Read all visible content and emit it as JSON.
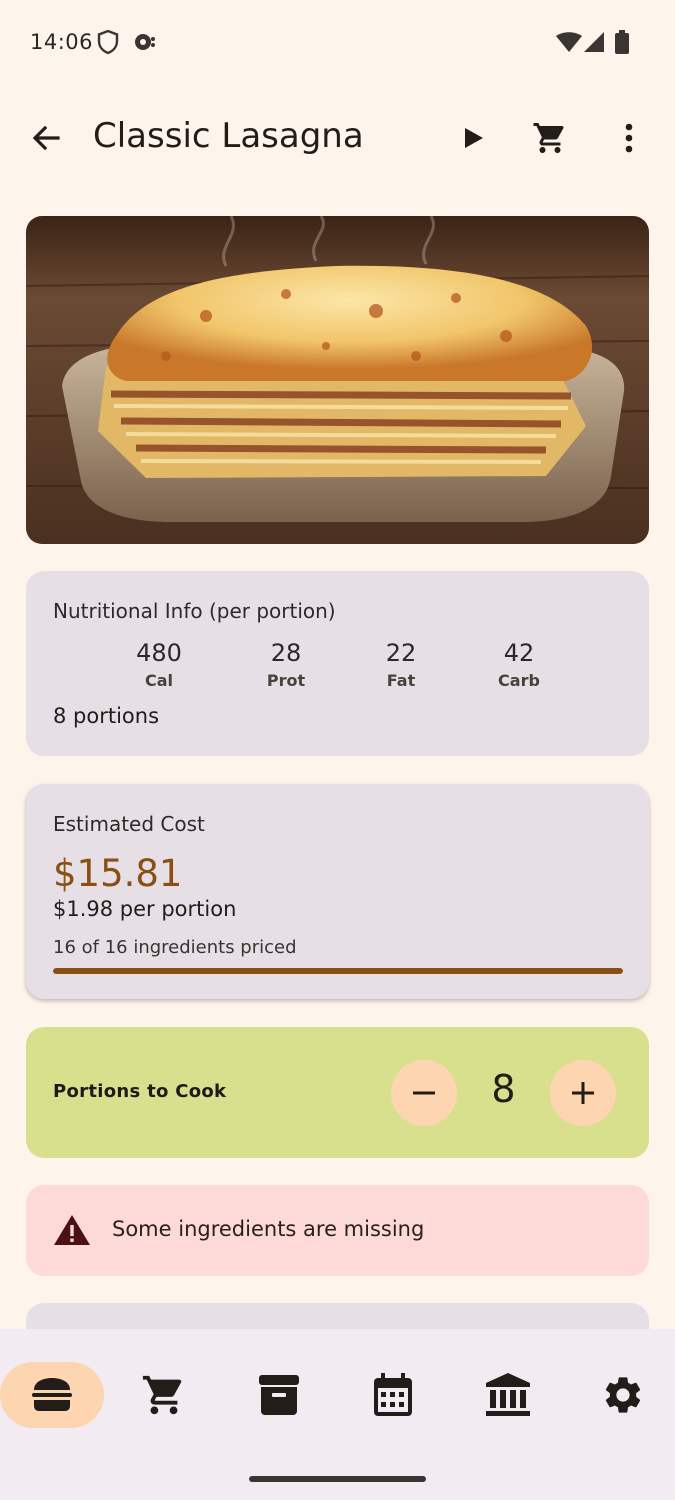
{
  "status_bar": {
    "time": "14:06",
    "left_icons": [
      "shield-icon",
      "notification-bubble-icon"
    ],
    "right_icons": [
      "wifi-icon",
      "cell-signal-icon",
      "battery-icon"
    ]
  },
  "app_bar": {
    "title": "Classic Lasagna",
    "actions": [
      "back-arrow-icon",
      "play-icon",
      "cart-icon",
      "more-vert-icon"
    ]
  },
  "hero": {
    "image": "lasagna-photo"
  },
  "nutrition": {
    "heading": "Nutritional Info (per portion)",
    "items": [
      {
        "value": "480",
        "label": "Cal"
      },
      {
        "value": "28",
        "label": "Prot"
      },
      {
        "value": "22",
        "label": "Fat"
      },
      {
        "value": "42",
        "label": "Carb"
      }
    ],
    "portions": "8 portions"
  },
  "cost": {
    "heading": "Estimated Cost",
    "amount": "$15.81",
    "per_portion": "$1.98 per portion",
    "priced": "16 of 16 ingredients priced",
    "progress": 1.0
  },
  "portions_to_cook": {
    "label": "Portions to Cook",
    "value": "8"
  },
  "warning": {
    "text": "Some ingredients are missing"
  },
  "bottom_nav": {
    "items": [
      "burger-icon",
      "cart-icon",
      "archive-icon",
      "calendar-icon",
      "bank-icon",
      "gear-icon"
    ],
    "active_index": 0
  },
  "colors": {
    "background": "#fdf4ec",
    "accent": "#8a4f12",
    "stepper": "#fdd5b0",
    "portions_card": "#d8e08d",
    "warning_card": "#fdd9d7",
    "info_card": "#e6e0e6"
  }
}
